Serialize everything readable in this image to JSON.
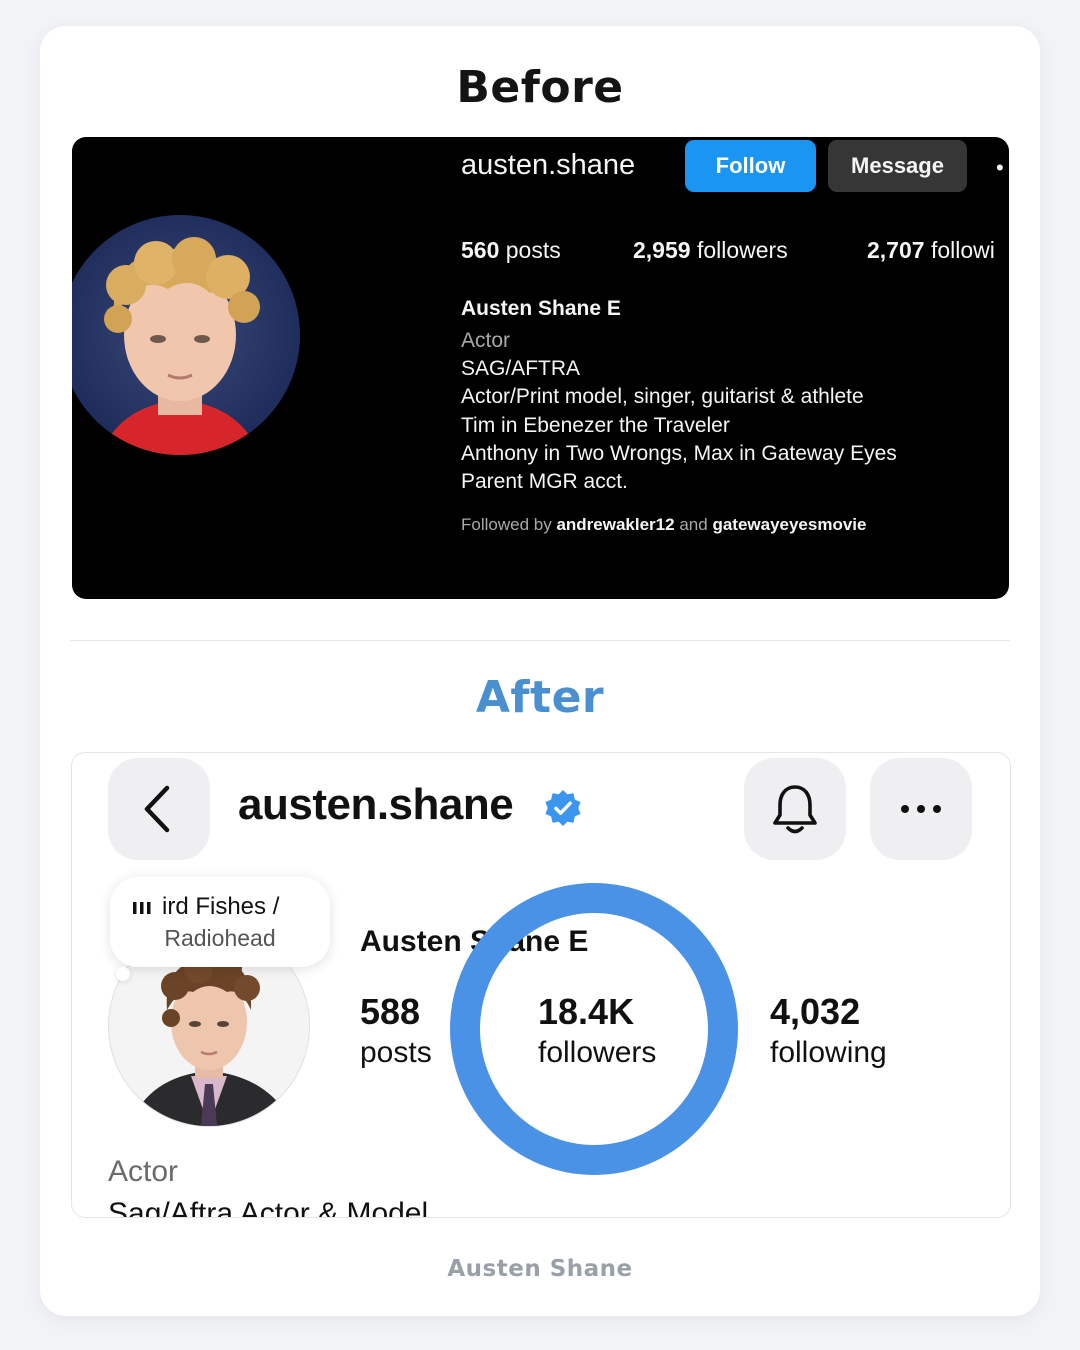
{
  "labels": {
    "before": "Before",
    "after": "After",
    "caption": "Austen Shane"
  },
  "before": {
    "username": "austen.shane",
    "follow": "Follow",
    "message": "Message",
    "more": "•",
    "stats": [
      {
        "num": "560",
        "label": "posts"
      },
      {
        "num": "2,959",
        "label": "followers"
      },
      {
        "num": "2,707",
        "label": "followi"
      }
    ],
    "name": "Austen Shane E",
    "bio": [
      "Actor",
      "SAG/AFTRA",
      "Actor/Print model, singer, guitarist & athlete",
      "Tim in Ebenezer the Traveler",
      "Anthony in Two Wrongs, Max in Gateway Eyes",
      "Parent MGR acct."
    ],
    "followed_prefix": "Followed by",
    "followed_a": "andrewakler12",
    "followed_and": "and",
    "followed_b": "gatewayeyesmovie"
  },
  "after": {
    "username": "austen.shane",
    "note_song": "ird Fishes /",
    "note_artist": "Radiohead",
    "display_name": "Austen Shane E",
    "stats": [
      {
        "num": "588",
        "label": "posts"
      },
      {
        "num": "18.4K",
        "label": "followers"
      },
      {
        "num": "4,032",
        "label": "following"
      }
    ],
    "category": "Actor",
    "bio": "Sag/Aftra Actor & Model"
  },
  "colors": {
    "highlight_ring": "#4a92e6",
    "follow_button": "#1a95f2",
    "after_heading": "#4a8fd0"
  },
  "icons": [
    "back-chevron-icon",
    "bell-icon",
    "more-dots-icon",
    "verified-badge-icon",
    "music-bars-icon"
  ]
}
